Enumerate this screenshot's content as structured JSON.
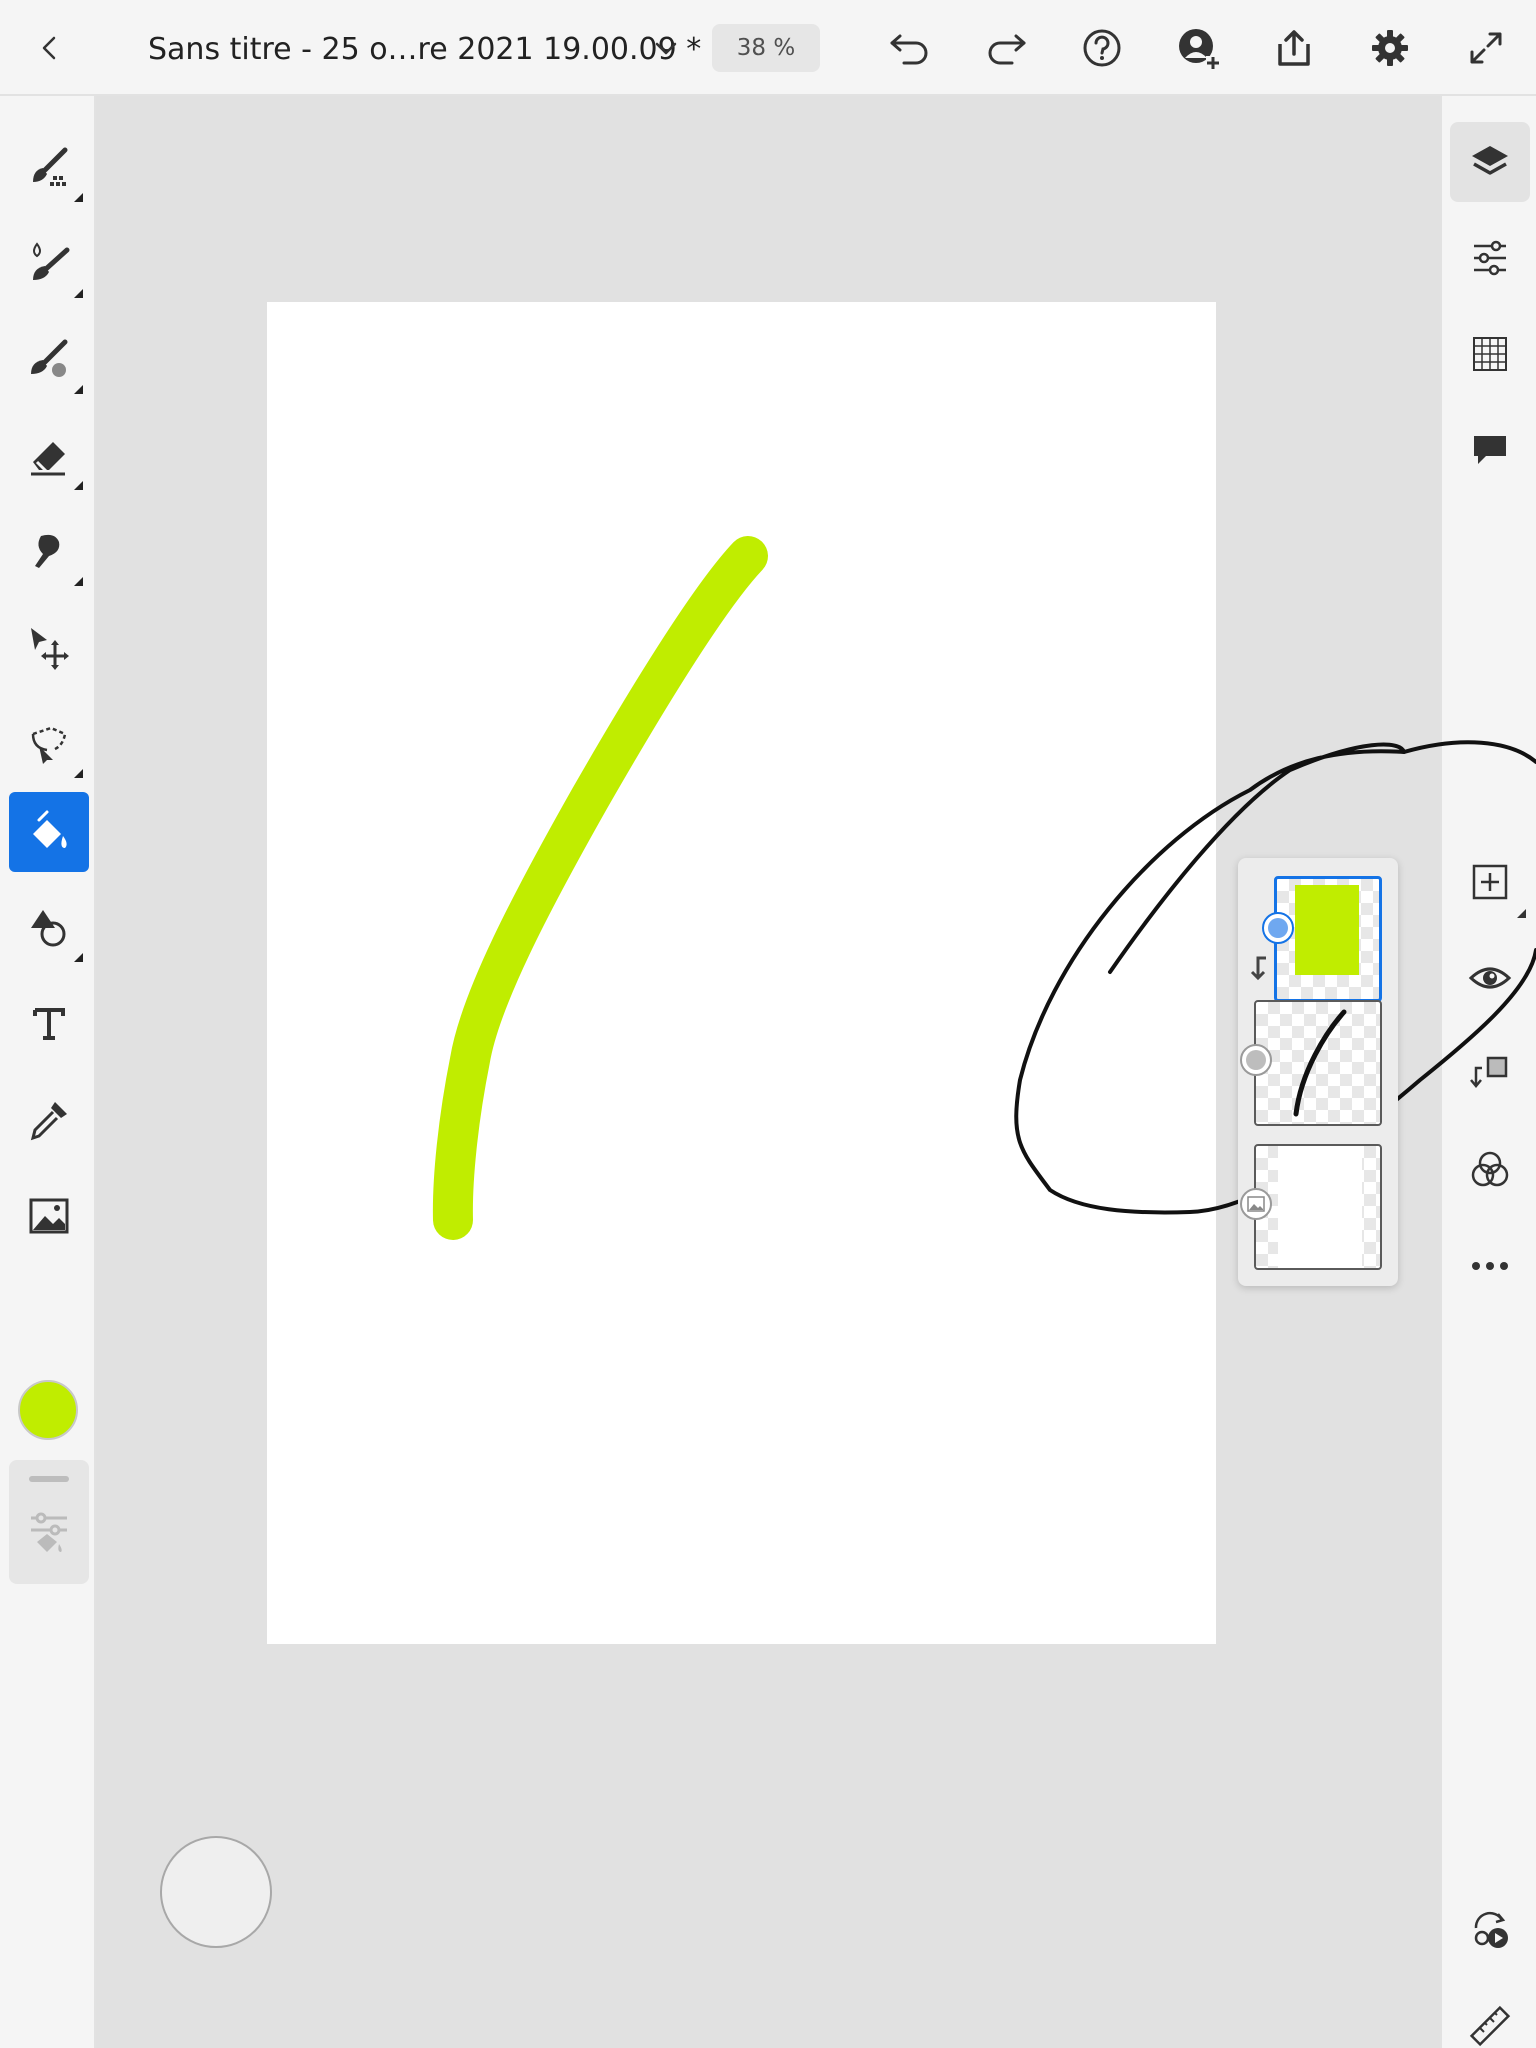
{
  "header": {
    "document_title": "Sans titre - 25 o…re 2021 19.00.09 *",
    "zoom": "38 %"
  },
  "left_toolbar": {
    "tools": [
      {
        "name": "pixel-brush",
        "icon": "pixel-brush-icon"
      },
      {
        "name": "live-brush",
        "icon": "live-brush-icon"
      },
      {
        "name": "vector-brush",
        "icon": "vector-brush-icon"
      },
      {
        "name": "eraser",
        "icon": "eraser-icon"
      },
      {
        "name": "smudge",
        "icon": "smudge-icon"
      },
      {
        "name": "transform",
        "icon": "move-icon"
      },
      {
        "name": "selection",
        "icon": "lasso-icon"
      },
      {
        "name": "fill",
        "icon": "paint-bucket-icon",
        "active": true
      },
      {
        "name": "shapes",
        "icon": "shapes-icon"
      },
      {
        "name": "text",
        "icon": "text-icon"
      },
      {
        "name": "eyedropper",
        "icon": "eyedropper-icon"
      },
      {
        "name": "place-image",
        "icon": "image-icon"
      }
    ],
    "current_color": "#c0ed00"
  },
  "right_toolbar": {
    "items": [
      "layers-icon",
      "adjustments-icon",
      "grid-icon",
      "comment-icon",
      "add-layer-icon",
      "visibility-icon",
      "clipping-mask-icon",
      "blend-mode-icon",
      "more-icon",
      "timelapse-icon",
      "ruler-icon"
    ]
  },
  "layers": [
    {
      "type": "fill",
      "color": "#c0ed00",
      "selected": true,
      "clipped": true
    },
    {
      "type": "stroke",
      "selected": false
    },
    {
      "type": "background",
      "selected": false
    }
  ],
  "colors": {
    "accent": "#1473e6",
    "stroke": "#c0ed00",
    "toolbar_bg": "#f5f5f5",
    "workspace_bg": "#e1e1e1"
  }
}
